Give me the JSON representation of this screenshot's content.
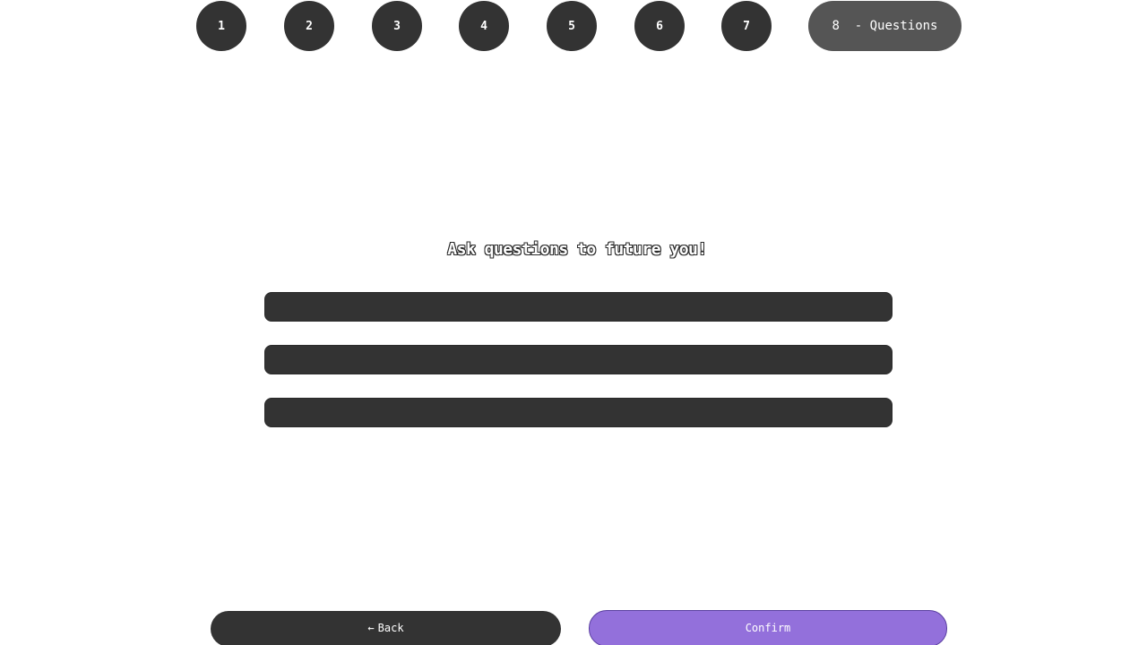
{
  "steps": [
    {
      "label": "1"
    },
    {
      "label": "2"
    },
    {
      "label": "3"
    },
    {
      "label": "4"
    },
    {
      "label": "5"
    },
    {
      "label": "6"
    },
    {
      "label": "7"
    },
    {
      "label": "8  - Questions"
    }
  ],
  "main": {
    "title": "Ask questions to future you!",
    "questions": [
      {
        "value": "",
        "placeholder": ""
      },
      {
        "value": "",
        "placeholder": ""
      },
      {
        "value": "",
        "placeholder": ""
      }
    ]
  },
  "footer": {
    "back_icon": "←",
    "back_label": "Back",
    "confirm_label": "Confirm"
  },
  "colors": {
    "step_bg": "#333333",
    "active_step_bg": "#555555",
    "input_bg": "#333333",
    "confirm_bg": "#9370db",
    "back_bg": "#333333"
  }
}
